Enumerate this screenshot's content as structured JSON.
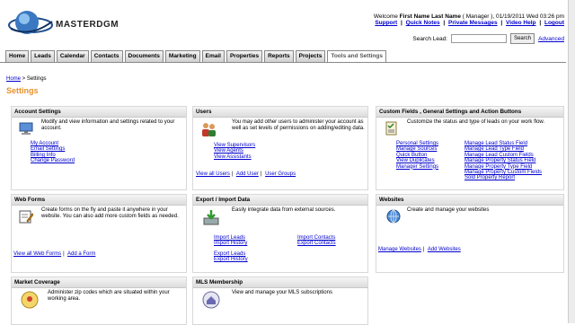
{
  "brand": {
    "name": "MASTERDGM"
  },
  "welcome": {
    "prefix": "Welcome",
    "user_name": "First Name Last Name",
    "role": "( Manager )",
    "datetime": ", 01/19/2011 Wed 03:26 pm"
  },
  "top_links": [
    "Support",
    "Quick Notes",
    "Private Messages",
    "Video Help",
    "Logout"
  ],
  "search": {
    "label": "Search Lead:",
    "value": "",
    "button": "Search",
    "advanced": "Advanced"
  },
  "tabs": [
    "Home",
    "Leads",
    "Calendar",
    "Contacts",
    "Documents",
    "Marketing",
    "Email",
    "Properties",
    "Reports",
    "Projects",
    "Tools and Settings"
  ],
  "breadcrumb": {
    "home": "Home",
    "sep": " > ",
    "current": "Settings"
  },
  "page_title": "Settings",
  "panels": {
    "account": {
      "title": "Account Settings",
      "desc": "Modify and view information and settings related to your account.",
      "links": [
        "My Account",
        "Email Settings",
        "Billing Info",
        "Change Password"
      ]
    },
    "users": {
      "title": "Users",
      "desc": "You may add other users to administer your account as well as set levels of permissions on adding/editing data.",
      "links": [
        "View Supervisors",
        "View Agents",
        "View Assistants"
      ],
      "footer": [
        "View all Users",
        "Add User",
        "User Groups"
      ]
    },
    "custom": {
      "title": "Custom Fields , General Settings and Action Buttons",
      "desc": "Customize the status and type of leads on your work flow.",
      "links_left": [
        "Personal Settings",
        "Manage Sources",
        "Quick Button",
        "View Duplicates",
        "Manager Settings"
      ],
      "links_right": [
        "Manage Lead Status Field",
        "Manage Lead Type Field",
        "Manage Lead Custom Fields",
        "Manage Property Status Field",
        "Manage Property Type Field",
        "Manage Property Custom Fields",
        "Sold Property Report"
      ]
    },
    "webforms": {
      "title": "Web Forms",
      "desc": "Create forms on the fly and paste it anywhere in your website. You can also add more custom fields as needed.",
      "footer": [
        "View all Web Forms",
        "Add a Form"
      ]
    },
    "export": {
      "title": "Export / Import Data",
      "desc": "Easily integrate data from external sources.",
      "links_left_a": [
        "Import Leads",
        "Import History"
      ],
      "links_left_b": [
        "Export Leads",
        "Export History"
      ],
      "links_right": [
        "Import Contacts",
        "Export Contacts"
      ]
    },
    "websites": {
      "title": "Websites",
      "desc": "Create and manage your websites",
      "footer": [
        "Manage Websites",
        "Add Websites"
      ]
    },
    "market": {
      "title": "Market Coverage",
      "desc": "Administer zip codes which are situated within your working area."
    },
    "mls": {
      "title": "MLS Membership",
      "desc": "View and manage your MLS subscriptions"
    }
  }
}
